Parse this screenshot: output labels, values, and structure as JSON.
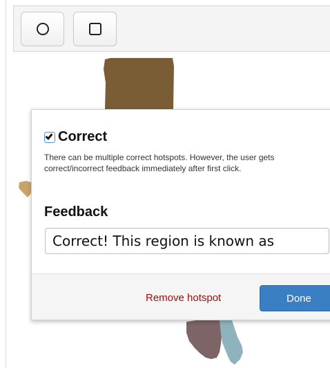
{
  "toolbar": {
    "tools": [
      {
        "name": "circle",
        "icon": "circle-outline-icon"
      },
      {
        "name": "rectangle",
        "icon": "square-outline-icon"
      }
    ]
  },
  "map": {
    "region_colors": {
      "top_block": "#7a5d35",
      "left_nub": "#c8a46a",
      "bottom_left": "#7c6467",
      "bottom_right": "#8fb3bd"
    }
  },
  "popover": {
    "correct_checked": true,
    "correct_label": "Correct",
    "help_text": "There can be multiple correct hotspots. However, the user gets correct/incorrect feedback immediately after first click.",
    "feedback_label": "Feedback",
    "feedback_value": "Correct! This region is known as",
    "remove_label": "Remove hotspot",
    "done_label": "Done",
    "colors": {
      "remove_link": "#a10d0d",
      "done_button": "#3a7fc3"
    }
  }
}
